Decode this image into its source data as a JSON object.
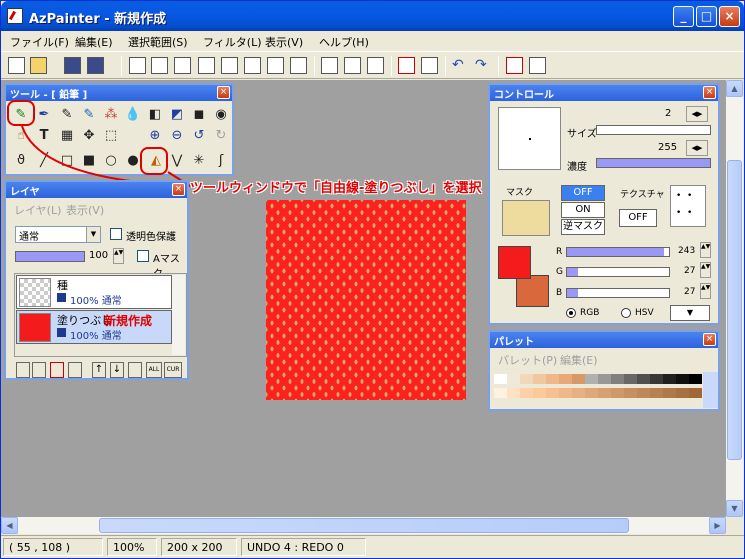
{
  "window": {
    "title": "AzPainter - 新規作成"
  },
  "caption_buttons": {
    "minimize": "_",
    "maximize": "□",
    "close": "×"
  },
  "menu": [
    "ファイル(F)",
    "編集(E)",
    "選択範囲(S)",
    "フィルタ(L)",
    "表示(V)",
    "ヘルプ(H)"
  ],
  "tool_panel": {
    "title": "ツール - [ 鉛筆 ]"
  },
  "annotation": {
    "text": "ツールウィンドウで「自由線-塗りつぶし」を選択",
    "new_layer_text": "新規作成"
  },
  "layer_panel": {
    "title": "レイヤ",
    "menu": [
      "レイヤ(L)",
      "表示(V)"
    ],
    "blend_mode": "通常",
    "preserve_alpha_label": "透明色保護",
    "opacity_value": "100",
    "amask_label": "Aマスク",
    "layers": [
      {
        "name": "種",
        "info": "100% 通常"
      },
      {
        "name": "塗りつぶし",
        "info": "100% 通常"
      }
    ],
    "bottom_buttons": [
      "ALL",
      "CUR"
    ]
  },
  "control_panel": {
    "title": "コントロール",
    "size_label": "サイズ",
    "size_value": "2",
    "density_label": "濃度",
    "density_value": "255",
    "mask_label": "マスク",
    "mask_buttons": [
      "OFF",
      "ON",
      "逆マスク"
    ],
    "texture_label": "テクスチャ",
    "texture_button": "OFF",
    "r_label": "R",
    "r_value": "243",
    "g_label": "G",
    "g_value": "27",
    "b_label": "B",
    "b_value": "27",
    "rgb_label": "RGB",
    "hsv_label": "HSV",
    "main_color": "#f31b1b",
    "sub_color": "#d9683c",
    "mask_color": "#eedc9f",
    "density_fraction": 1.0,
    "size_fraction": 0.0,
    "r_fraction": 0.95,
    "g_fraction": 0.106,
    "b_fraction": 0.106
  },
  "palette_panel": {
    "title": "パレット",
    "menu": [
      "パレット(P)",
      "編集(E)"
    ],
    "row1": [
      "#ffffff",
      "#f0e8d8",
      "#f0d8b8",
      "#f0c8a0",
      "#f0b888",
      "#e8a878",
      "#d89868",
      "#b0b0b0",
      "#989898",
      "#808080",
      "#686868",
      "#505050",
      "#383838",
      "#202020",
      "#101010",
      "#000000"
    ],
    "row2": [
      "#fff0e0",
      "#ffe0c0",
      "#ffd0a8",
      "#ffc898",
      "#f8c090",
      "#f0b888",
      "#e8b080",
      "#e0a878",
      "#d8a070",
      "#d09868",
      "#c89060",
      "#c08858",
      "#b88050",
      "#b07848",
      "#a87040",
      "#a06838"
    ]
  },
  "status": {
    "coords": "( 55 , 108 )",
    "zoom": "100%",
    "size": "200 x 200",
    "undo": "UNDO 4 : REDO 0"
  }
}
